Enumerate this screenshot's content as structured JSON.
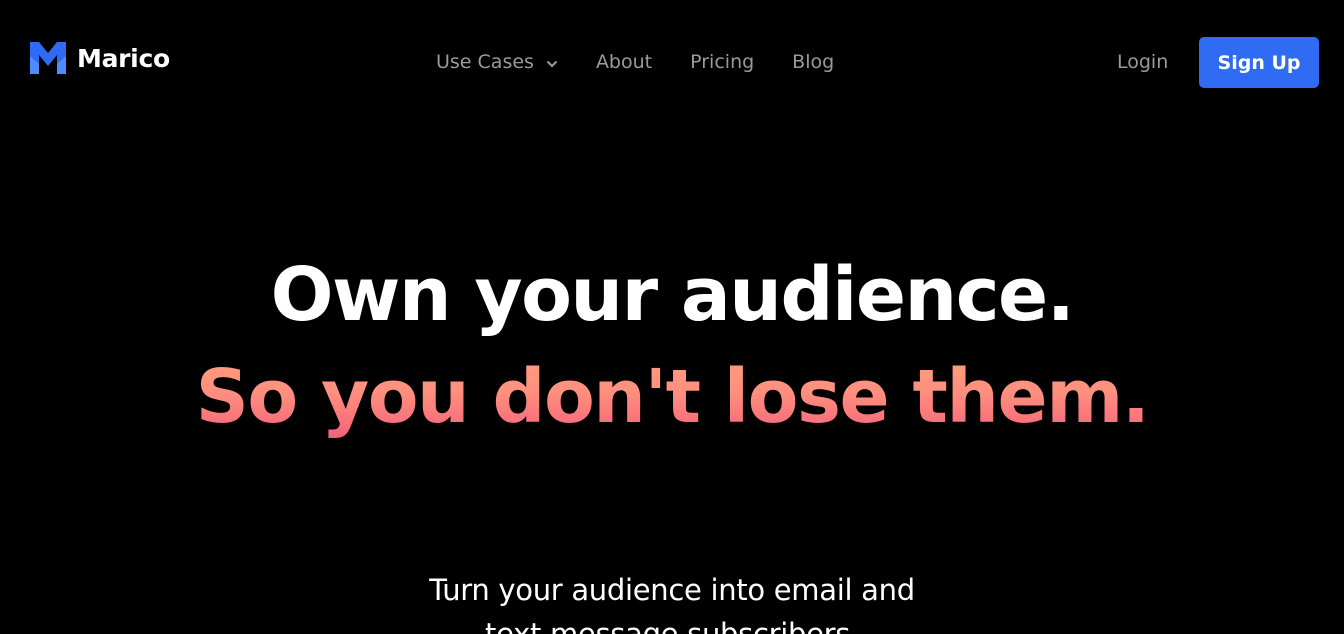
{
  "brand": {
    "name": "Marico",
    "logo_icon": "marico-m-logo",
    "logo_colors": [
      "#2f6bf3",
      "#4f8cff"
    ]
  },
  "nav": {
    "items": [
      {
        "label": "Use Cases",
        "has_dropdown": true,
        "icon": "chevron-down-icon"
      },
      {
        "label": "About"
      },
      {
        "label": "Pricing"
      },
      {
        "label": "Blog"
      }
    ]
  },
  "auth": {
    "login_label": "Login",
    "signup_label": "Sign Up"
  },
  "hero": {
    "headline_line1": "Own your audience.",
    "headline_line2": "So you don't lose them.",
    "subheadline_line1": "Turn your audience into email and",
    "subheadline_line2": "text message subscribers."
  },
  "colors": {
    "background": "#000000",
    "accent": "#2f6bf3",
    "nav_text": "#9a9a9a",
    "gradient_top": "#ffa07c",
    "gradient_bottom": "#f45f7a"
  }
}
